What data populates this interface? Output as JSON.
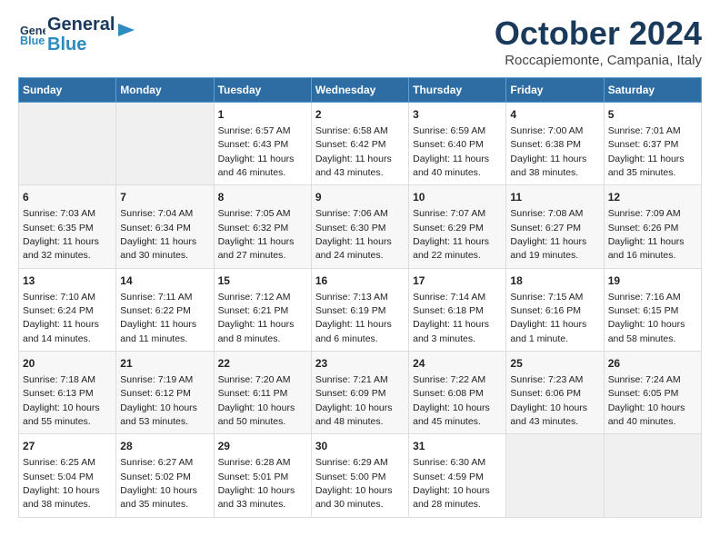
{
  "logo": {
    "line1": "General",
    "line2": "Blue"
  },
  "title": "October 2024",
  "subtitle": "Roccapiemonte, Campania, Italy",
  "days_of_week": [
    "Sunday",
    "Monday",
    "Tuesday",
    "Wednesday",
    "Thursday",
    "Friday",
    "Saturday"
  ],
  "weeks": [
    [
      {
        "day": "",
        "empty": true
      },
      {
        "day": "",
        "empty": true
      },
      {
        "day": "1",
        "sunrise": "6:57 AM",
        "sunset": "6:43 PM",
        "daylight": "11 hours and 46 minutes."
      },
      {
        "day": "2",
        "sunrise": "6:58 AM",
        "sunset": "6:42 PM",
        "daylight": "11 hours and 43 minutes."
      },
      {
        "day": "3",
        "sunrise": "6:59 AM",
        "sunset": "6:40 PM",
        "daylight": "11 hours and 40 minutes."
      },
      {
        "day": "4",
        "sunrise": "7:00 AM",
        "sunset": "6:38 PM",
        "daylight": "11 hours and 38 minutes."
      },
      {
        "day": "5",
        "sunrise": "7:01 AM",
        "sunset": "6:37 PM",
        "daylight": "11 hours and 35 minutes."
      }
    ],
    [
      {
        "day": "6",
        "sunrise": "7:03 AM",
        "sunset": "6:35 PM",
        "daylight": "11 hours and 32 minutes."
      },
      {
        "day": "7",
        "sunrise": "7:04 AM",
        "sunset": "6:34 PM",
        "daylight": "11 hours and 30 minutes."
      },
      {
        "day": "8",
        "sunrise": "7:05 AM",
        "sunset": "6:32 PM",
        "daylight": "11 hours and 27 minutes."
      },
      {
        "day": "9",
        "sunrise": "7:06 AM",
        "sunset": "6:30 PM",
        "daylight": "11 hours and 24 minutes."
      },
      {
        "day": "10",
        "sunrise": "7:07 AM",
        "sunset": "6:29 PM",
        "daylight": "11 hours and 22 minutes."
      },
      {
        "day": "11",
        "sunrise": "7:08 AM",
        "sunset": "6:27 PM",
        "daylight": "11 hours and 19 minutes."
      },
      {
        "day": "12",
        "sunrise": "7:09 AM",
        "sunset": "6:26 PM",
        "daylight": "11 hours and 16 minutes."
      }
    ],
    [
      {
        "day": "13",
        "sunrise": "7:10 AM",
        "sunset": "6:24 PM",
        "daylight": "11 hours and 14 minutes."
      },
      {
        "day": "14",
        "sunrise": "7:11 AM",
        "sunset": "6:22 PM",
        "daylight": "11 hours and 11 minutes."
      },
      {
        "day": "15",
        "sunrise": "7:12 AM",
        "sunset": "6:21 PM",
        "daylight": "11 hours and 8 minutes."
      },
      {
        "day": "16",
        "sunrise": "7:13 AM",
        "sunset": "6:19 PM",
        "daylight": "11 hours and 6 minutes."
      },
      {
        "day": "17",
        "sunrise": "7:14 AM",
        "sunset": "6:18 PM",
        "daylight": "11 hours and 3 minutes."
      },
      {
        "day": "18",
        "sunrise": "7:15 AM",
        "sunset": "6:16 PM",
        "daylight": "11 hours and 1 minute."
      },
      {
        "day": "19",
        "sunrise": "7:16 AM",
        "sunset": "6:15 PM",
        "daylight": "10 hours and 58 minutes."
      }
    ],
    [
      {
        "day": "20",
        "sunrise": "7:18 AM",
        "sunset": "6:13 PM",
        "daylight": "10 hours and 55 minutes."
      },
      {
        "day": "21",
        "sunrise": "7:19 AM",
        "sunset": "6:12 PM",
        "daylight": "10 hours and 53 minutes."
      },
      {
        "day": "22",
        "sunrise": "7:20 AM",
        "sunset": "6:11 PM",
        "daylight": "10 hours and 50 minutes."
      },
      {
        "day": "23",
        "sunrise": "7:21 AM",
        "sunset": "6:09 PM",
        "daylight": "10 hours and 48 minutes."
      },
      {
        "day": "24",
        "sunrise": "7:22 AM",
        "sunset": "6:08 PM",
        "daylight": "10 hours and 45 minutes."
      },
      {
        "day": "25",
        "sunrise": "7:23 AM",
        "sunset": "6:06 PM",
        "daylight": "10 hours and 43 minutes."
      },
      {
        "day": "26",
        "sunrise": "7:24 AM",
        "sunset": "6:05 PM",
        "daylight": "10 hours and 40 minutes."
      }
    ],
    [
      {
        "day": "27",
        "sunrise": "6:25 AM",
        "sunset": "5:04 PM",
        "daylight": "10 hours and 38 minutes."
      },
      {
        "day": "28",
        "sunrise": "6:27 AM",
        "sunset": "5:02 PM",
        "daylight": "10 hours and 35 minutes."
      },
      {
        "day": "29",
        "sunrise": "6:28 AM",
        "sunset": "5:01 PM",
        "daylight": "10 hours and 33 minutes."
      },
      {
        "day": "30",
        "sunrise": "6:29 AM",
        "sunset": "5:00 PM",
        "daylight": "10 hours and 30 minutes."
      },
      {
        "day": "31",
        "sunrise": "6:30 AM",
        "sunset": "4:59 PM",
        "daylight": "10 hours and 28 minutes."
      },
      {
        "day": "",
        "empty": true
      },
      {
        "day": "",
        "empty": true
      }
    ]
  ],
  "labels": {
    "sunrise": "Sunrise:",
    "sunset": "Sunset:",
    "daylight": "Daylight:"
  }
}
